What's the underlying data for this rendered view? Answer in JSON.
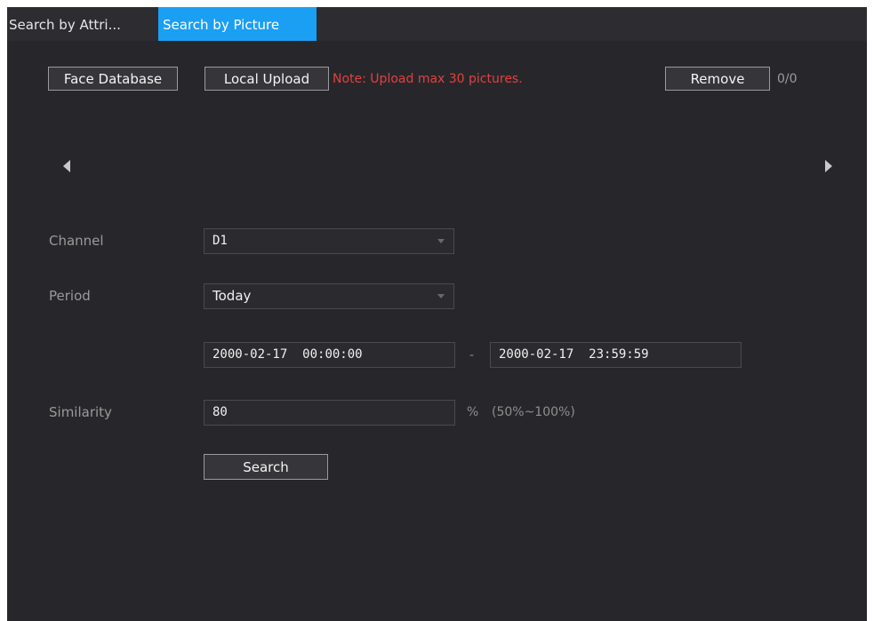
{
  "tabs": [
    {
      "label": "Search by Attri...",
      "active": false
    },
    {
      "label": "Search by Picture",
      "active": true
    }
  ],
  "toolbar": {
    "face_database_label": "Face Database",
    "local_upload_label": "Local Upload",
    "upload_note": "Note: Upload max 30 pictures.",
    "remove_label": "Remove",
    "picture_count": "0/0"
  },
  "form": {
    "channel_label": "Channel",
    "channel_value": "D1",
    "period_label": "Period",
    "period_value": "Today",
    "start_date": "2000-02-17",
    "start_time": "00:00:00",
    "range_separator": "-",
    "end_date": "2000-02-17",
    "end_time": "23:59:59",
    "similarity_label": "Similarity",
    "similarity_value": "80",
    "similarity_unit": "%",
    "similarity_range": "(50%~100%)",
    "search_label": "Search"
  },
  "colors": {
    "tab_active": "#1b9ff3",
    "note": "#e0413f",
    "background": "#27272b"
  },
  "icons": {
    "prev": "left-triangle-arrow",
    "next": "right-triangle-arrow",
    "dropdown": "down-triangle-caret"
  }
}
